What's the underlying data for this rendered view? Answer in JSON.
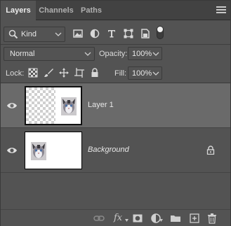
{
  "tabs": [
    {
      "label": "Layers",
      "active": true
    },
    {
      "label": "Channels",
      "active": false
    },
    {
      "label": "Paths",
      "active": false
    }
  ],
  "filter": {
    "kind_label": "Kind",
    "icons": [
      "pixel-filter-icon",
      "adjustment-filter-icon",
      "type-filter-icon",
      "shape-filter-icon",
      "smart-object-filter-icon",
      "filter-toggle-icon"
    ]
  },
  "blend": {
    "mode": "Normal",
    "opacity_label": "Opacity:",
    "opacity_value": "100%"
  },
  "locks": {
    "label": "Lock:",
    "icons": [
      "lock-transparent-pixels-icon",
      "lock-image-pixels-icon",
      "lock-position-icon",
      "lock-artboard-icon",
      "lock-all-icon"
    ],
    "fill_label": "Fill:",
    "fill_value": "100%"
  },
  "layers": [
    {
      "name": "Layer 1",
      "selected": true,
      "visible": true,
      "locked": false
    },
    {
      "name": "Background",
      "selected": false,
      "visible": true,
      "locked": true
    }
  ],
  "footer": {
    "fx_label": "fx",
    "icons": [
      "link-layers-icon",
      "layer-style-icon",
      "add-mask-icon",
      "adjustment-layer-icon",
      "new-group-icon",
      "new-layer-icon",
      "delete-layer-icon"
    ]
  },
  "colors": {
    "panel_bg": "#535353",
    "tabbar_bg": "#424242",
    "selected_row": "#6a6a6a",
    "text": "#dcdcdc"
  }
}
